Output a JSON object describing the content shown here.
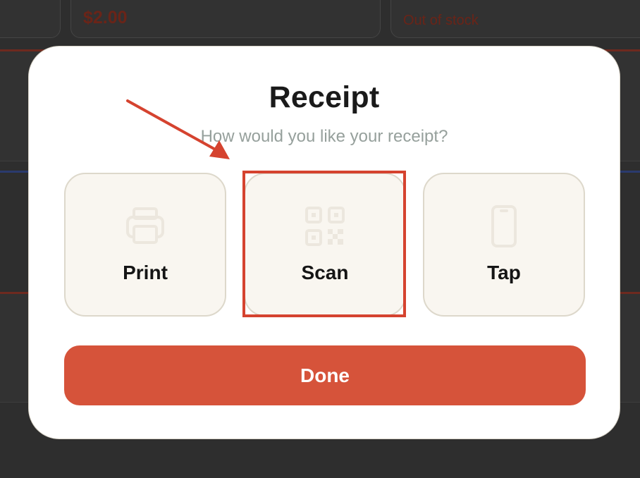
{
  "background": {
    "price": "$2.00",
    "stock_status": "Out of stock"
  },
  "receipt_modal": {
    "title": "Receipt",
    "subtitle": "How would you like your receipt?",
    "options": [
      {
        "label": "Print",
        "icon": "printer-icon"
      },
      {
        "label": "Scan",
        "icon": "qr-code-icon"
      },
      {
        "label": "Tap",
        "icon": "phone-icon"
      }
    ],
    "done_label": "Done"
  },
  "annotation": {
    "highlighted_option": "Scan",
    "color": "#d5432f"
  },
  "colors": {
    "accent": "#d6533a",
    "modal_bg": "#ffffff",
    "option_bg": "#f9f6f0",
    "subtitle": "#96a09c"
  }
}
